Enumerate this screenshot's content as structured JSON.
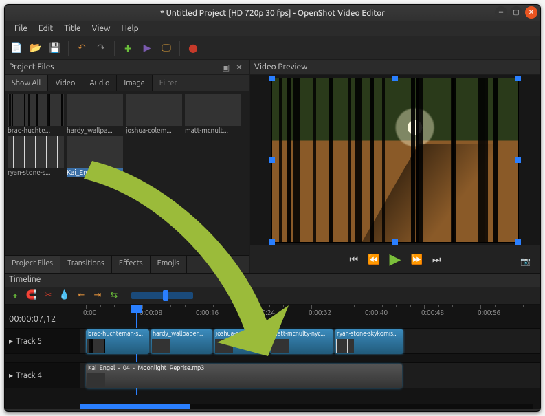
{
  "window": {
    "title": "* Untitled Project [HD 720p 30 fps] - OpenShot Video Editor"
  },
  "menubar": [
    "File",
    "Edit",
    "Title",
    "View",
    "Help"
  ],
  "panels": {
    "project_files_title": "Project Files",
    "video_preview_title": "Video Preview"
  },
  "project_file_tabs": {
    "show_all": "Show All",
    "video": "Video",
    "audio": "Audio",
    "image": "Image",
    "filter_placeholder": "Filter"
  },
  "project_files": [
    {
      "label": "brad-huchte..."
    },
    {
      "label": "hardy_wallpa..."
    },
    {
      "label": "joshua-colem..."
    },
    {
      "label": "matt-mcnult..."
    },
    {
      "label": "ryan-stone-s..."
    },
    {
      "label": "Kai_Engel_-..."
    }
  ],
  "bottom_tabs": {
    "project_files": "Project Files",
    "transitions": "Transitions",
    "effects": "Effects",
    "emojis": "Emojis"
  },
  "timeline": {
    "title": "Timeline",
    "timecode": "00:00:07,12",
    "ruler": [
      "0:00",
      "0:00:08",
      "0:00:16",
      "0:00:24",
      "0:00:32",
      "0:00:40",
      "0:00:48",
      "0:00:56"
    ],
    "tracks": {
      "t5": "Track 5",
      "t4": "Track 4"
    },
    "clips_t5": [
      "brad-huchteman-s...",
      "hardy_wallpaper...",
      "joshua-colem...",
      "matt-mcnulty-nyc...",
      "ryan-stone-skykomis..."
    ],
    "clip_t4": "Kai_Engel_-_04_-_Moonlight_Reprise.mp3"
  }
}
